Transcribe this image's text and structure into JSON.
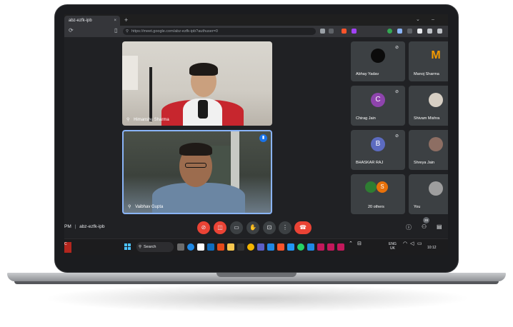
{
  "browser": {
    "tab_title": "abz-ezfk-ipb",
    "tab_close": "×",
    "new_tab": "+",
    "url": "https://meet.google.com/abz-ezfk-ipb?authuser=0",
    "window_controls": [
      "⌄",
      "–"
    ]
  },
  "videos": [
    {
      "name": "Himanshu Sharma",
      "speaking": false
    },
    {
      "name": "Vaibhav Gupta",
      "speaking": true
    }
  ],
  "participants": [
    {
      "name": "Abhay Yadav",
      "muted": true,
      "avatar_letter": "",
      "avatar_color": "#111111"
    },
    {
      "name": "Manoj Sharma",
      "muted": false,
      "avatar_letter": "M",
      "avatar_color": "#f29900"
    },
    {
      "name": "Chirag Jain",
      "muted": true,
      "avatar_letter": "C",
      "avatar_color": "#8e44ad"
    },
    {
      "name": "Shivam Mishra",
      "muted": false,
      "avatar_letter": "",
      "avatar_color": "#d7cfc4"
    },
    {
      "name": "BHASKAR RAJ",
      "muted": true,
      "avatar_letter": "B",
      "avatar_color": "#5c6bc0"
    },
    {
      "name": "Shreya Jain",
      "muted": false,
      "avatar_letter": "",
      "avatar_color": "#8d6e63"
    },
    {
      "name": "20 others",
      "muted": false,
      "avatar_letter": "S",
      "avatar_color": "#e8710a"
    },
    {
      "name": "You",
      "muted": false,
      "avatar_letter": "",
      "avatar_color": "#9e9e9e"
    }
  ],
  "meeting": {
    "time_suffix": "PM",
    "separator": "|",
    "code": "abz-ezfk-ipb",
    "people_count": "28"
  },
  "taskbar": {
    "search_label": "Search",
    "lang": "ENG",
    "region": "UK",
    "clock": "10:12",
    "weather_letter": "C"
  },
  "colors": {
    "accent_blue": "#8ab4f8",
    "end_call_red": "#ea4335",
    "meet_bg": "#202124",
    "tile_bg": "#3c4043"
  },
  "icons": {
    "mic_off": "mic-off-icon",
    "cam_off": "camera-off-icon",
    "captions": "captions-icon",
    "raise_hand": "raise-hand-icon",
    "present": "present-icon",
    "more": "more-icon",
    "end": "end-call-icon",
    "info": "info-icon",
    "people": "people-icon",
    "chat": "chat-icon"
  }
}
